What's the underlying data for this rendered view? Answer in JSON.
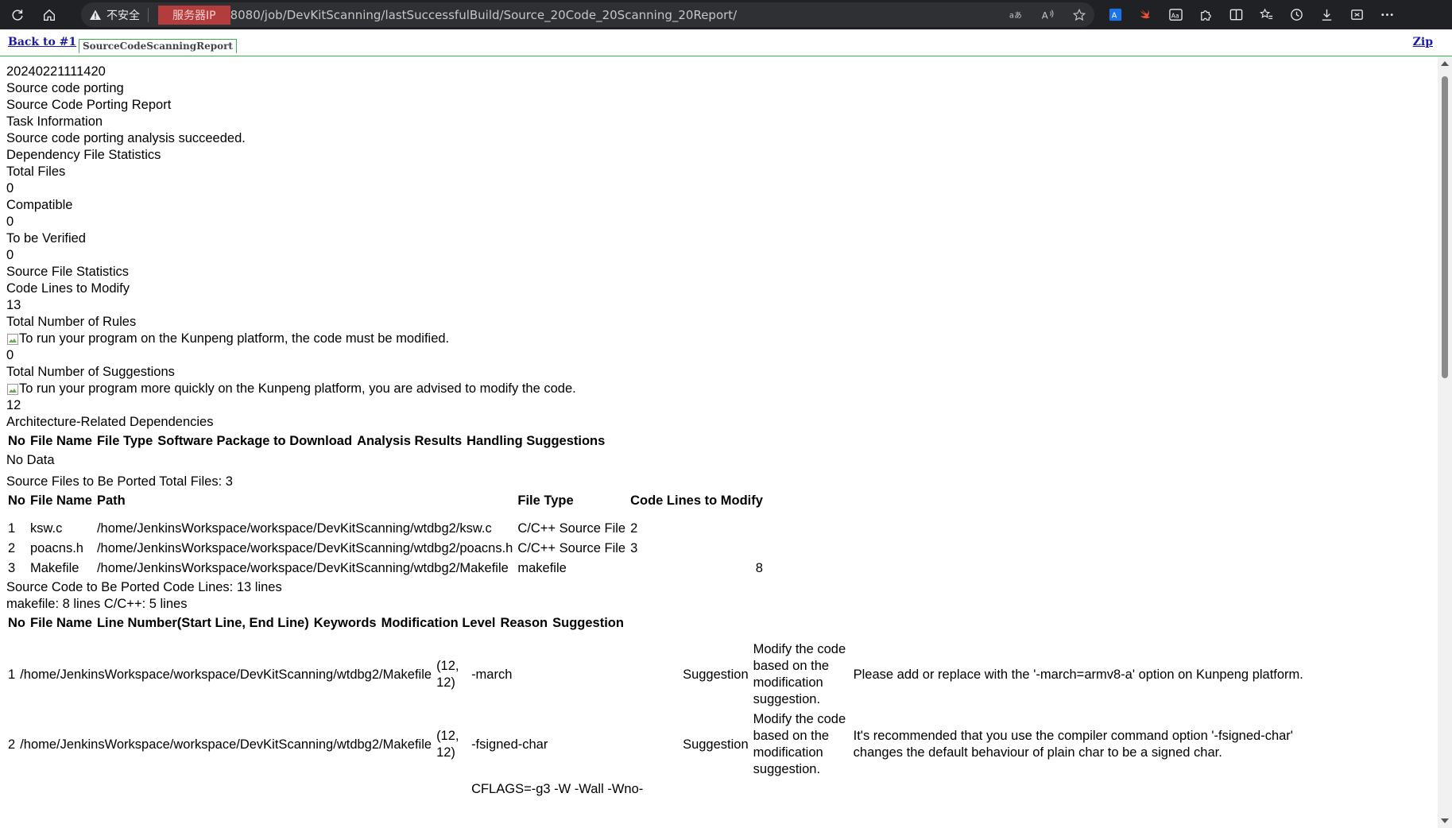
{
  "browser": {
    "insecure_label": "不安全",
    "ip_placeholder": "服务器IP",
    "url_rest": "8080/job/DevKitScanning/lastSuccessfulBuild/Source_20Code_20Scanning_20Report/"
  },
  "publisher": {
    "back_label": "Back to #1",
    "tab_label": "SourceCodeScanningReport",
    "zip_label": "Zip"
  },
  "report": {
    "timestamp": "20240221111420",
    "section_title": "Source code porting",
    "report_title": "Source Code Porting Report",
    "task_info_label": "Task Information",
    "status_text": "Source code porting analysis succeeded.",
    "dep_stats_label": "Dependency File Statistics",
    "total_files_label": "Total Files",
    "total_files_value": "0",
    "compatible_label": "Compatible",
    "compatible_value": "0",
    "to_be_verified_label": "To be Verified",
    "to_be_verified_value": "0",
    "source_stats_label": "Source File Statistics",
    "code_lines_label": "Code Lines to Modify",
    "code_lines_value": "13",
    "total_rules_label": "Total Number of Rules",
    "rules_img_alt": "To run your program on the Kunpeng platform, the code must be modified.",
    "total_rules_value": "0",
    "total_suggestions_label": "Total Number of Suggestions",
    "suggestions_img_alt": "To run your program more quickly on the Kunpeng platform, you are advised to modify the code.",
    "total_suggestions_value": "12",
    "arch_deps_label": "Architecture-Related Dependencies",
    "dep_table_headers": [
      "No",
      "File Name",
      "File Type",
      "Software Package to Download",
      "Analysis Results",
      "Handling Suggestions"
    ],
    "no_data_text": "No Data",
    "to_port_summary": "Source Files to Be Ported Total Files: 3",
    "files_table_headers": [
      "No",
      "File Name",
      "Path",
      "File Type",
      "Code Lines to Modify"
    ],
    "files_rows": [
      {
        "no": "1",
        "name": "ksw.c",
        "path": "/home/JenkinsWorkspace/workspace/DevKitScanning/wtdbg2/ksw.c",
        "type": "C/C++ Source File",
        "lines": "2"
      },
      {
        "no": "2",
        "name": "poacns.h",
        "path": "/home/JenkinsWorkspace/workspace/DevKitScanning/wtdbg2/poacns.h",
        "type": "C/C++ Source File",
        "lines": "3"
      },
      {
        "no": "3",
        "name": "Makefile",
        "path": "/home/JenkinsWorkspace/workspace/DevKitScanning/wtdbg2/Makefile",
        "type": "makefile",
        "lines": "8"
      }
    ],
    "code_lines_summary": "Source Code to Be Ported Code Lines:   13 lines",
    "code_lines_breakdown": "makefile: 8 lines C/C++: 5 lines",
    "detail_table_headers": [
      "No",
      "File Name",
      "Line Number(Start Line, End Line)",
      "Keywords",
      "Modification Level",
      "Reason",
      "Suggestion"
    ],
    "detail_rows": [
      {
        "no": "1",
        "file": "/home/JenkinsWorkspace/workspace/DevKitScanning/wtdbg2/Makefile",
        "line": "(12, 12)",
        "keyword": "-march",
        "level": "Suggestion",
        "reason": "Modify the code based on the modification suggestion.",
        "suggestion": "Please add or replace with the '-march=armv8-a' option on Kunpeng platform."
      },
      {
        "no": "2",
        "file": "/home/JenkinsWorkspace/workspace/DevKitScanning/wtdbg2/Makefile",
        "line": "(12, 12)",
        "keyword": "-fsigned-char",
        "level": "Suggestion",
        "reason": "Modify the code based on the modification suggestion.",
        "suggestion": "It's recommended that you use the compiler command option '-fsigned-char' changes the default behaviour of plain char to be a signed char."
      }
    ],
    "partial_row_keyword": "CFLAGS=-g3 -W -Wall -Wno-"
  }
}
